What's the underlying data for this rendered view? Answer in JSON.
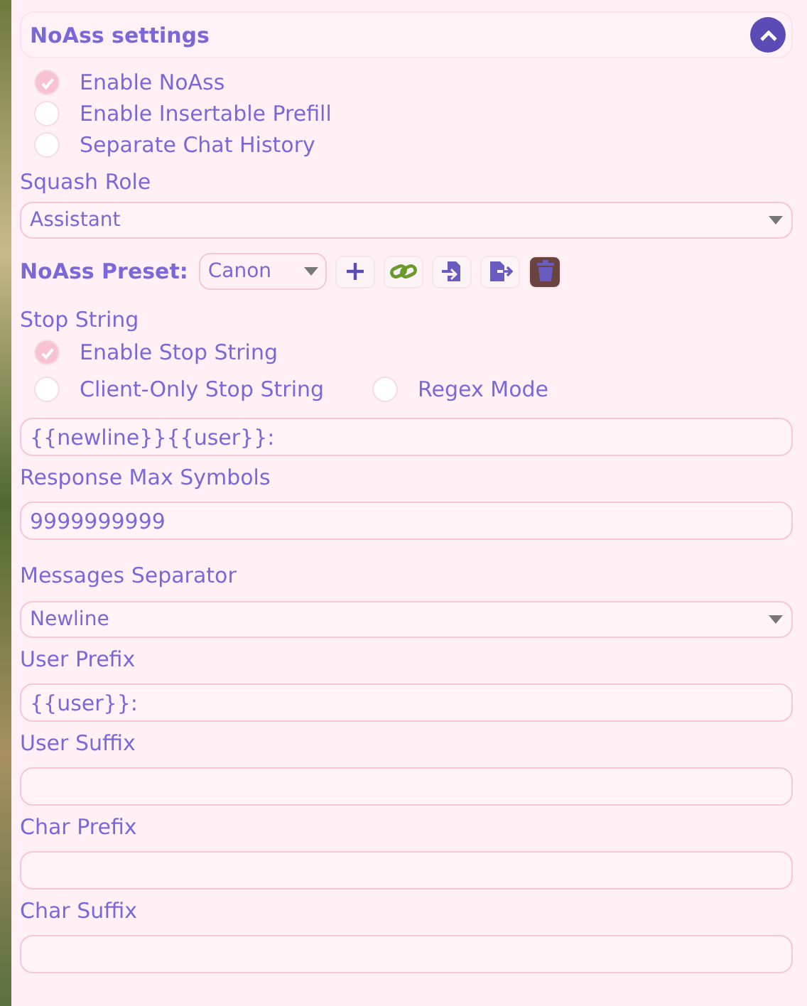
{
  "panel": {
    "title": "NoAss settings",
    "expanded": true
  },
  "toggles": [
    {
      "label": "Enable NoAss",
      "checked": true
    },
    {
      "label": "Enable Insertable Prefill",
      "checked": false
    },
    {
      "label": "Separate Chat History",
      "checked": false
    }
  ],
  "squash_role": {
    "label": "Squash Role",
    "value": "Assistant"
  },
  "preset": {
    "label": "NoAss Preset:",
    "value": "Canon"
  },
  "stop_string": {
    "label": "Stop String",
    "options": [
      {
        "label": "Enable Stop String",
        "checked": true
      },
      {
        "label": "Client-Only Stop String",
        "checked": false
      },
      {
        "label": "Regex Mode",
        "checked": false
      }
    ],
    "value": "{{newline}}{{user}}:"
  },
  "fields": [
    {
      "kind": "input",
      "label": "Response Max Symbols",
      "value": "9999999999"
    },
    {
      "kind": "select",
      "label": "Messages Separator",
      "value": "Newline"
    },
    {
      "kind": "input",
      "label": "User Prefix",
      "value": "{{user}}:"
    },
    {
      "kind": "input",
      "label": "User Suffix"
    },
    {
      "kind": "input",
      "label": "Char Prefix"
    },
    {
      "kind": "input",
      "label": "Char Suffix"
    }
  ]
}
